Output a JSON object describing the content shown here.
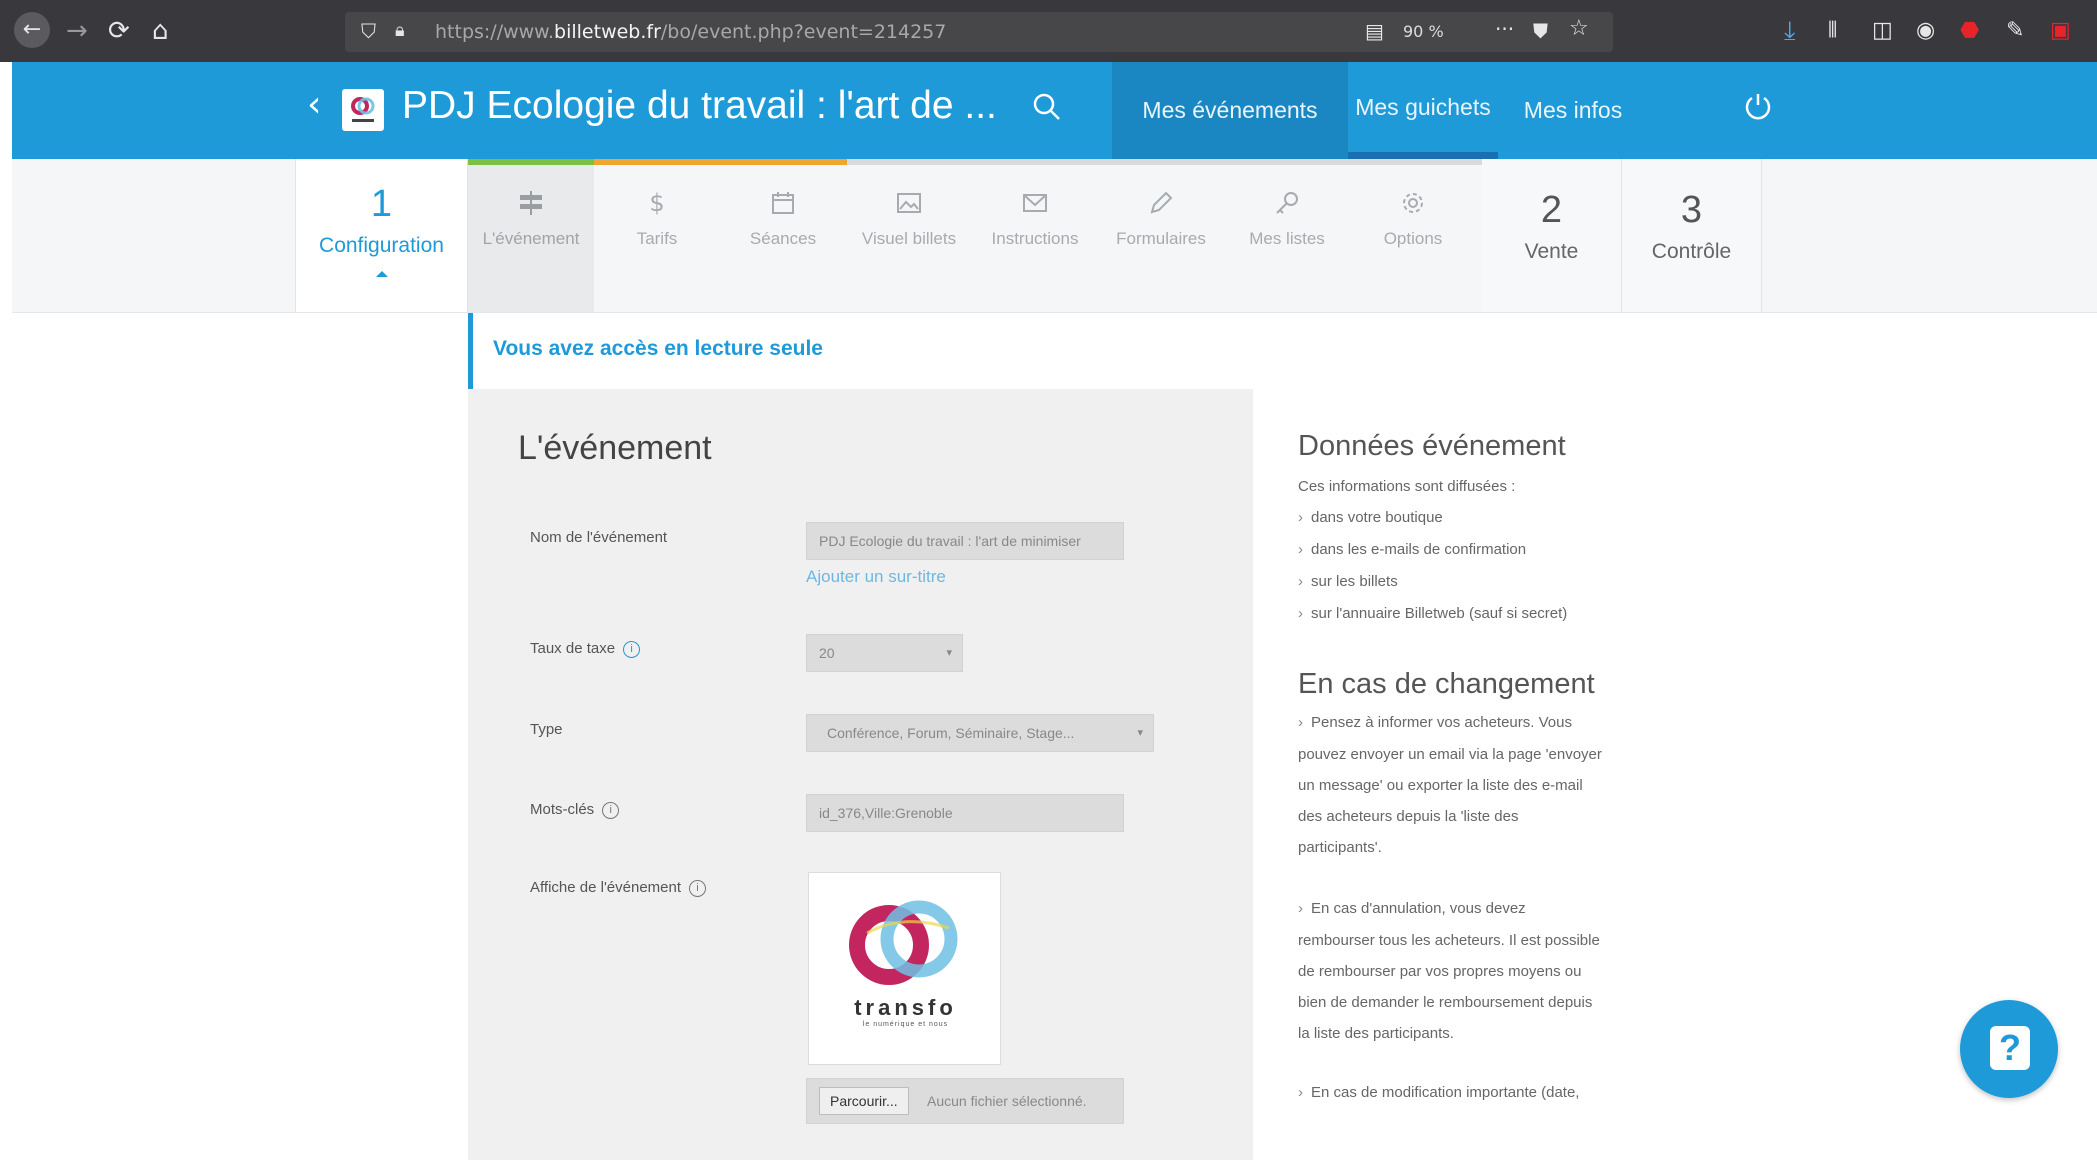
{
  "browser": {
    "url_prefix": "https://www.",
    "url_domain": "billetweb.fr",
    "url_path": "/bo/event.php?event=214257",
    "zoom": "90 %"
  },
  "header": {
    "title": "PDJ Ecologie du travail : l'art de ...",
    "nav": [
      {
        "label": "Mes événements"
      },
      {
        "label": "Mes guichets"
      },
      {
        "label": "Mes infos"
      }
    ]
  },
  "steps": {
    "config": {
      "num": "1",
      "label": "Configuration"
    },
    "substeps": [
      {
        "label": "L'événement",
        "icon": "signpost-icon"
      },
      {
        "label": "Tarifs",
        "icon": "dollar-icon"
      },
      {
        "label": "Séances",
        "icon": "calendar-icon"
      },
      {
        "label": "Visuel billets",
        "icon": "image-icon"
      },
      {
        "label": "Instructions",
        "icon": "envelope-icon"
      },
      {
        "label": "Formulaires",
        "icon": "pencil-icon"
      },
      {
        "label": "Mes listes",
        "icon": "key-icon"
      },
      {
        "label": "Options",
        "icon": "gear-icon"
      }
    ],
    "vente": {
      "num": "2",
      "label": "Vente"
    },
    "controle": {
      "num": "3",
      "label": "Contrôle"
    },
    "colors": {
      "done": "#7dc142",
      "current": "#f0a431",
      "pending": "#d8dadc"
    }
  },
  "readonly_notice": "Vous avez accès en lecture seule",
  "form": {
    "title": "L'événement",
    "fields": {
      "name_label": "Nom de l'événement",
      "name_value": "PDJ Ecologie du travail : l'art de minimiser",
      "add_subtitle": "Ajouter un sur-titre",
      "tax_label": "Taux de taxe",
      "tax_value": "20",
      "type_label": "Type",
      "type_value": "Conférence, Forum, Séminaire, Stage...",
      "keywords_label": "Mots-clés",
      "keywords_value": "id_376,Ville:Grenoble",
      "poster_label": "Affiche de l'événement"
    },
    "poster": {
      "brand": "transfo",
      "tagline": "le numérique et nous"
    },
    "file": {
      "button": "Parcourir...",
      "status": "Aucun fichier sélectionné."
    }
  },
  "sidebar": {
    "heading1": "Données événement",
    "intro": "Ces informations sont diffusées :",
    "items": [
      "dans votre boutique",
      "dans les e-mails de confirmation",
      "sur les billets",
      "sur l'annuaire Billetweb (sauf si secret)"
    ],
    "heading2": "En cas de changement",
    "para1_lines": [
      "Pensez à informer vos acheteurs. Vous",
      "pouvez envoyer un email via la page 'envoyer",
      "un message' ou exporter la liste des e-mail",
      "des acheteurs depuis la 'liste des",
      "participants'."
    ],
    "para2_lines": [
      "En cas d'annulation, vous devez",
      "rembourser tous les acheteurs. Il est possible",
      "de rembourser par vos propres moyens ou",
      "bien de demander le remboursement depuis",
      "la liste des participants."
    ],
    "para3_line": "En cas de modification importante (date,"
  },
  "help": {
    "glyph": "?"
  },
  "brand_color": "#1e9ad8"
}
